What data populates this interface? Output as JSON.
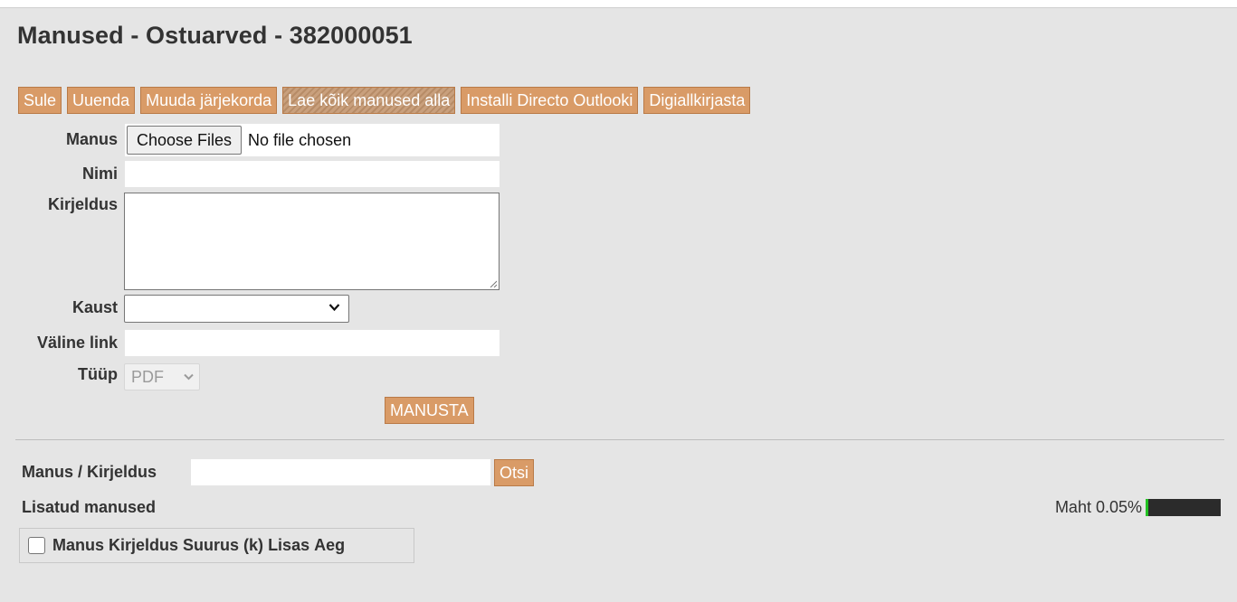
{
  "page": {
    "title": "Manused - Ostuarved - 382000051"
  },
  "toolbar": {
    "buttons": [
      {
        "label": "Sule"
      },
      {
        "label": "Uuenda"
      },
      {
        "label": "Muuda järjekorda"
      },
      {
        "label": "Lae kõik manused alla"
      },
      {
        "label": "Installi Directo Outlooki"
      },
      {
        "label": "Digiallkirjasta"
      }
    ]
  },
  "form": {
    "manus_label": "Manus",
    "choose_files_label": "Choose Files",
    "file_status": "No file chosen",
    "nimi_label": "Nimi",
    "nimi_value": "",
    "kirjeldus_label": "Kirjeldus",
    "kirjeldus_value": "",
    "kaust_label": "Kaust",
    "kaust_value": "",
    "valine_link_label": "Väline link",
    "valine_link_value": "",
    "tyyp_label": "Tüüp",
    "tyyp_value": "PDF",
    "submit_label": "MANUSTA"
  },
  "search": {
    "label": "Manus / Kirjeldus",
    "value": "",
    "button_label": "Otsi"
  },
  "attachments": {
    "title": "Lisatud manused",
    "capacity_label": "Maht 0.05%",
    "capacity_fraction": 0.05,
    "columns": [
      "Manus",
      "Kirjeldus",
      "Suurus (k)",
      "Lisas",
      "Aeg"
    ]
  },
  "colors": {
    "button_bg": "#d99b67",
    "page_bg": "#e5e5e5",
    "capacity_fill": "#22c022",
    "capacity_track": "#2b2b2b"
  }
}
